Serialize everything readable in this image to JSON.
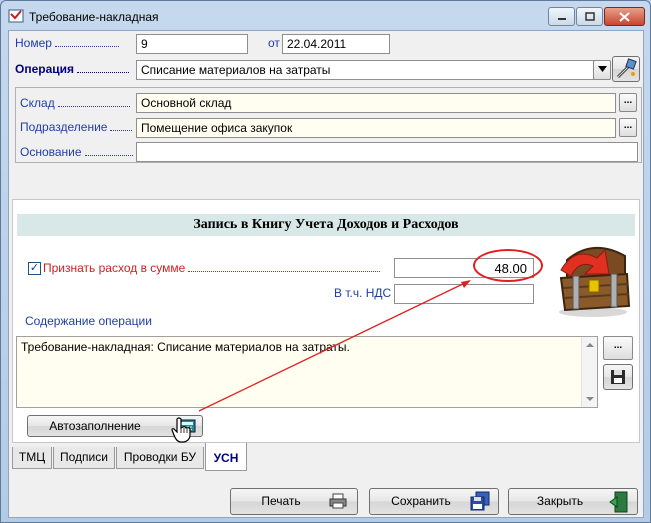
{
  "window": {
    "title": "Требование-накладная"
  },
  "header": {
    "number_label": "Номер",
    "number_value": "9",
    "date_label": "от",
    "date_value": "22.04.2011",
    "operation_label": "Операция",
    "operation_value": "Списание материалов на затраты"
  },
  "group": {
    "warehouse_label": "Склад",
    "warehouse_value": "Основной склад",
    "department_label": "Подразделение",
    "department_value": "Помещение офиса закупок",
    "basis_label": "Основание",
    "basis_value": "",
    "ellipsis": "..."
  },
  "panel": {
    "heading": "Запись в Книгу Учета Доходов и Расходов",
    "expense_checkbox_label": "Признать расход в сумме",
    "expense_checked": true,
    "expense_amount": "48.00",
    "vat_label": "В т.ч. НДС",
    "vat_value": "",
    "content_label": "Содержание операции",
    "content_text": "Требование-накладная: Списание материалов на затраты.",
    "memo_button": "...",
    "autofill_button": "Автозаполнение"
  },
  "tabs": [
    {
      "label": "ТМЦ",
      "active": false
    },
    {
      "label": "Подписи",
      "active": false
    },
    {
      "label": "Проводки БУ",
      "active": false
    },
    {
      "label": "УСН",
      "active": true
    }
  ],
  "footer": {
    "print_label": "Печать",
    "save_label": "Сохранить",
    "close_label": "Закрыть"
  },
  "colors": {
    "label_blue": "#1f3ea8",
    "accent_red": "#e02020",
    "panel_header_bg": "#d7e8e6",
    "memo_bg": "#fffef0"
  },
  "icons": [
    "app-icon",
    "minimize-icon",
    "maximize-icon",
    "close-icon",
    "wand-icon",
    "treasure-chest-icon",
    "calculator-icon",
    "hand-cursor-icon",
    "save-disk-icon",
    "printer-icon",
    "save-floppy-icon",
    "exit-door-icon"
  ]
}
